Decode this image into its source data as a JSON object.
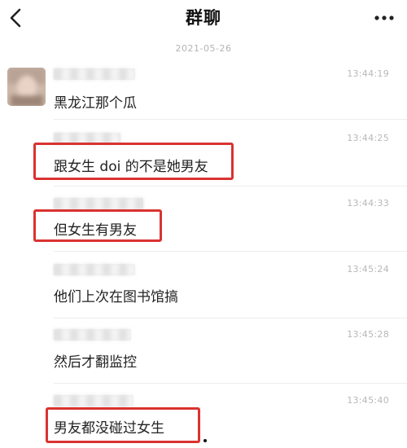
{
  "nav": {
    "title": "群聊"
  },
  "date_separator": "2021-05-26",
  "messages": [
    {
      "time": "13:44:19",
      "text": "黑龙江那个瓜"
    },
    {
      "time": "13:44:25",
      "text": "跟女生 doi 的不是她男友"
    },
    {
      "time": "13:44:33",
      "text": "但女生有男友"
    },
    {
      "time": "13:45:24",
      "text": "他们上次在图书馆搞"
    },
    {
      "time": "13:45:28",
      "text": "然后才翻监控"
    },
    {
      "time": "13:45:40",
      "text": "男友都没碰过女生"
    }
  ],
  "highlight_color": "#d93330",
  "icons": {
    "back": "chevron-left-icon",
    "more": "more-dots-icon"
  }
}
